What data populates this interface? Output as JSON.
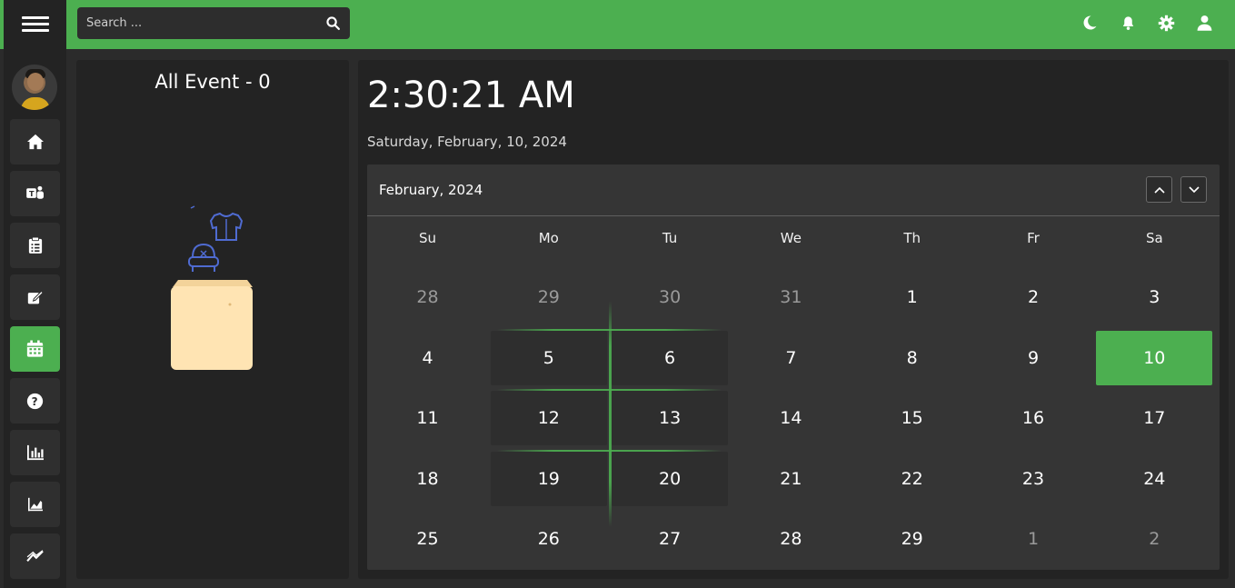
{
  "search": {
    "placeholder": "Search ..."
  },
  "header_icons": [
    "moon-icon",
    "bell-icon",
    "gear-icon",
    "user-icon"
  ],
  "sidebar": {
    "items": [
      {
        "name": "home",
        "icon": "home-icon"
      },
      {
        "name": "teams",
        "icon": "teams-icon"
      },
      {
        "name": "tasks",
        "icon": "clipboard-icon"
      },
      {
        "name": "notes",
        "icon": "edit-icon"
      },
      {
        "name": "calendar",
        "icon": "calendar-icon",
        "active": true
      },
      {
        "name": "help",
        "icon": "question-icon"
      },
      {
        "name": "bar-stats",
        "icon": "bar-chart-icon"
      },
      {
        "name": "area-stats",
        "icon": "area-chart-icon"
      },
      {
        "name": "trends",
        "icon": "trend-icon"
      }
    ]
  },
  "events": {
    "title": "All Event - 0"
  },
  "clock": {
    "time": "2:30:21 AM",
    "date": "Saturday, February, 10, 2024"
  },
  "calendar": {
    "month_label": "February, 2024",
    "weekdays": [
      "Su",
      "Mo",
      "Tu",
      "We",
      "Th",
      "Fr",
      "Sa"
    ],
    "weeks": [
      [
        "28",
        "29",
        "30",
        "31",
        "1",
        "2",
        "3"
      ],
      [
        "4",
        "5",
        "6",
        "7",
        "8",
        "9",
        "10"
      ],
      [
        "11",
        "12",
        "13",
        "14",
        "15",
        "16",
        "17"
      ],
      [
        "18",
        "19",
        "20",
        "21",
        "22",
        "23",
        "24"
      ],
      [
        "25",
        "26",
        "27",
        "28",
        "29",
        "1",
        "2"
      ]
    ],
    "today": "10"
  },
  "colors": {
    "accent": "#4caf50",
    "panel": "#232323",
    "calendar_bg": "#353535"
  }
}
